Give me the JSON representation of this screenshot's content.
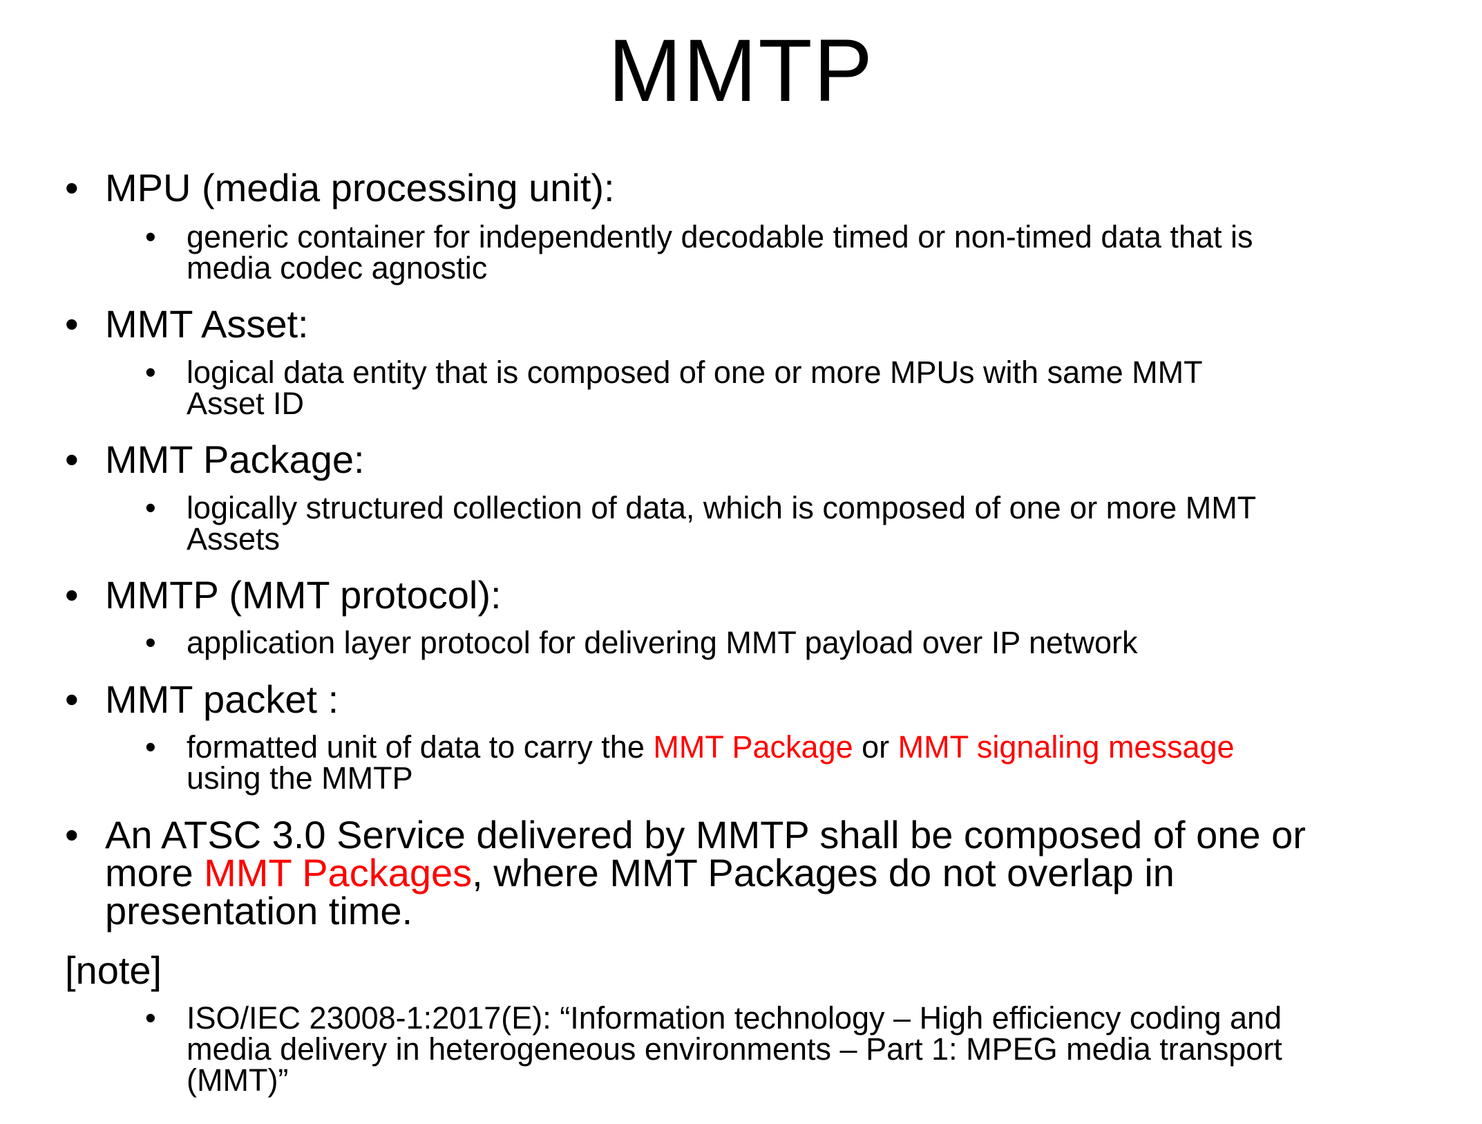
{
  "title": "MMTP",
  "items": [
    {
      "heading": "MPU (media processing unit):",
      "sub": [
        "generic container for independently decodable timed or non-timed data that is",
        "media codec agnostic"
      ]
    },
    {
      "heading": "MMT Asset:",
      "sub": [
        "logical data entity that is composed of one or more MPUs with same MMT",
        "Asset ID"
      ]
    },
    {
      "heading": "MMT Package:",
      "sub": [
        "logically structured collection of data, which is composed of one or more MMT",
        "Assets"
      ]
    },
    {
      "heading": "MMTP (MMT protocol):",
      "sub": [
        "application layer protocol for delivering MMT payload over IP network"
      ]
    },
    {
      "heading": "MMT packet :",
      "sub_parts": {
        "a": "formatted unit of data to carry the ",
        "b": "MMT Package",
        "c": " or ",
        "d": "MMT signaling message",
        "e": "using the MMTP"
      }
    }
  ],
  "service": {
    "line1": "An ATSC 3.0 Service delivered by MMTP shall be composed of one or",
    "line2_a": "more ",
    "line2_b": "MMT Packages",
    "line2_c": ", where MMT Packages do not overlap in",
    "line3": "presentation time."
  },
  "note": {
    "label": "[note]",
    "lines": [
      "ISO/IEC 23008-1:2017(E): “Information technology – High efficiency coding and",
      "media delivery in heterogeneous environments – Part 1: MPEG media transport",
      "(MMT)”"
    ]
  },
  "colors": {
    "text": "#000000",
    "highlight": "#ff0000",
    "background": "#ffffff"
  }
}
